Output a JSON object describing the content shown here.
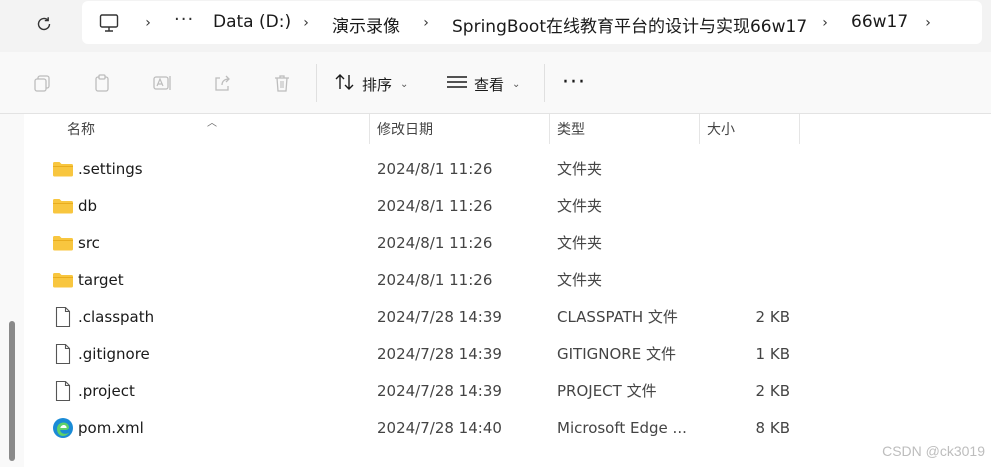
{
  "breadcrumb": {
    "ellipsis": "···",
    "items": [
      "Data (D:)",
      "演示录像",
      "SpringBoot在线教育平台的设计与实现66w17",
      "66w17"
    ]
  },
  "toolbar": {
    "sort_label": "排序",
    "view_label": "查看",
    "more_label": "···"
  },
  "columns": {
    "name": "名称",
    "date": "修改日期",
    "type": "类型",
    "size": "大小"
  },
  "files": [
    {
      "name": ".settings",
      "date": "2024/8/1 11:26",
      "type": "文件夹",
      "size": "",
      "icon": "folder-icon"
    },
    {
      "name": "db",
      "date": "2024/8/1 11:26",
      "type": "文件夹",
      "size": "",
      "icon": "folder-icon"
    },
    {
      "name": "src",
      "date": "2024/8/1 11:26",
      "type": "文件夹",
      "size": "",
      "icon": "folder-icon"
    },
    {
      "name": "target",
      "date": "2024/8/1 11:26",
      "type": "文件夹",
      "size": "",
      "icon": "folder-icon"
    },
    {
      "name": ".classpath",
      "date": "2024/7/28 14:39",
      "type": "CLASSPATH 文件",
      "size": "2 KB",
      "icon": "file-icon"
    },
    {
      "name": ".gitignore",
      "date": "2024/7/28 14:39",
      "type": "GITIGNORE 文件",
      "size": "1 KB",
      "icon": "file-icon"
    },
    {
      "name": ".project",
      "date": "2024/7/28 14:39",
      "type": "PROJECT 文件",
      "size": "2 KB",
      "icon": "file-icon"
    },
    {
      "name": "pom.xml",
      "date": "2024/7/28 14:40",
      "type": "Microsoft Edge ...",
      "size": "8 KB",
      "icon": "edge-icon"
    }
  ],
  "watermark": "CSDN @ck3019",
  "colors": {
    "folder": "#f8c63f",
    "edge": "#1a8bd6",
    "background": "#f3f3f3"
  }
}
